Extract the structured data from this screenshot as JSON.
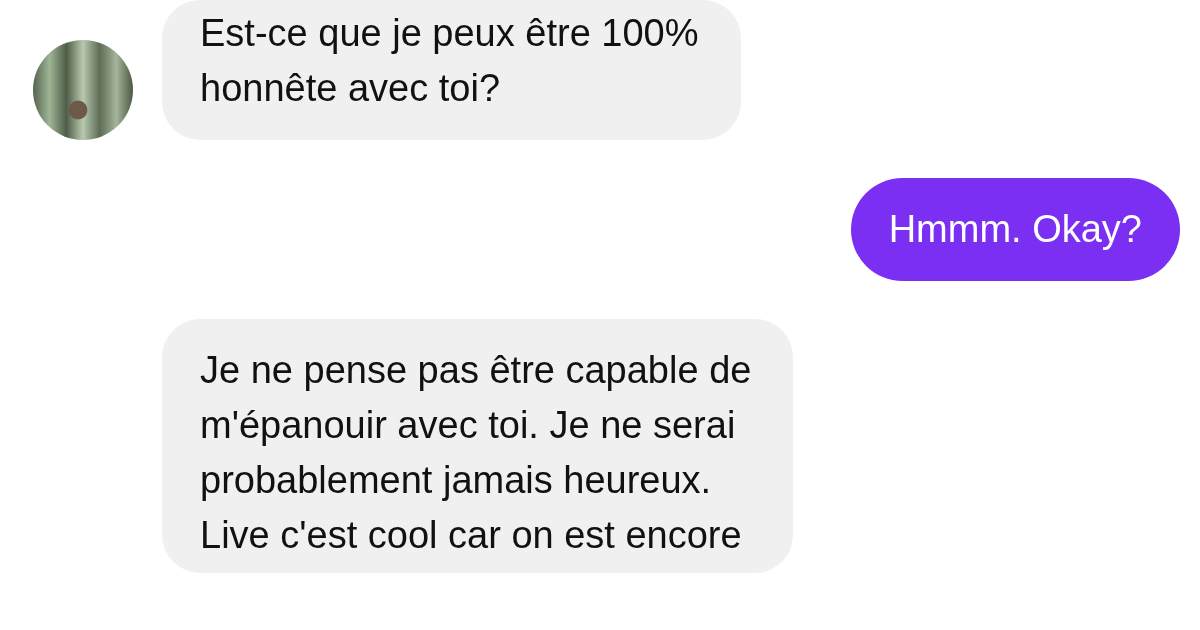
{
  "messages": [
    {
      "kind": "incoming",
      "avatar": true,
      "text": "Est-ce que je peux être 100%\nhonnête avec toi?"
    },
    {
      "kind": "outgoing",
      "avatar": false,
      "text": "Hmmm. Okay?"
    },
    {
      "kind": "incoming",
      "avatar": false,
      "text": "Je ne pense pas être capable de\nm'épanouir avec toi. Je ne serai\nprobablement jamais heureux.\nLive c'est cool car on est encore"
    }
  ]
}
